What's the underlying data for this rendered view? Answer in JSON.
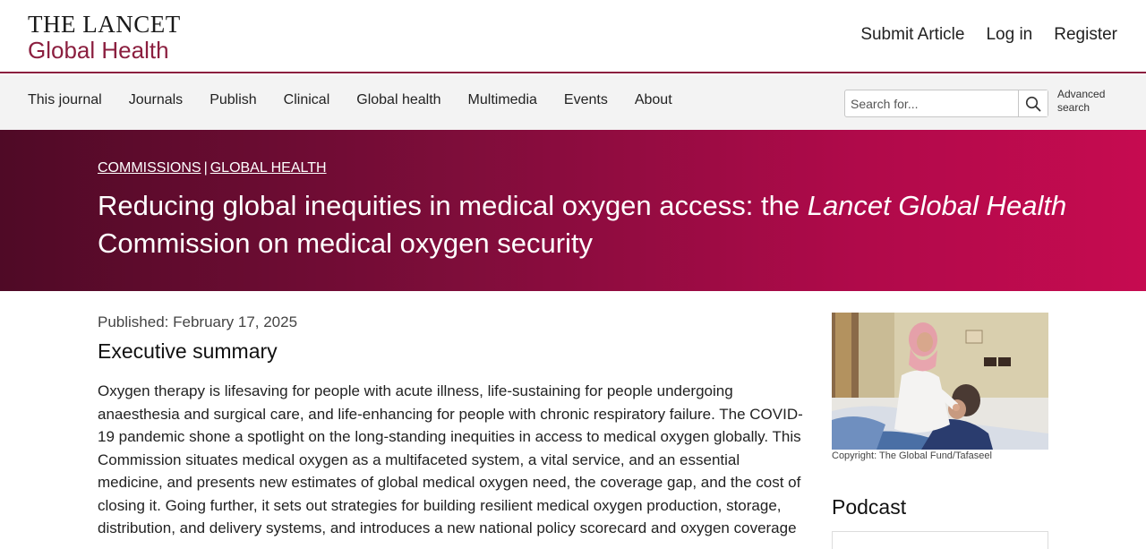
{
  "header": {
    "logo_line1": "THE LANCET",
    "logo_line2": "Global Health",
    "links": [
      "Submit Article",
      "Log in",
      "Register"
    ]
  },
  "nav": {
    "items": [
      "This journal",
      "Journals",
      "Publish",
      "Clinical",
      "Global health",
      "Multimedia",
      "Events",
      "About"
    ],
    "search_placeholder": "Search for...",
    "advanced_search_line1": "Advanced",
    "advanced_search_line2": "search"
  },
  "hero": {
    "breadcrumb": [
      "COMMISSIONS",
      "GLOBAL HEALTH"
    ],
    "breadcrumb_separator": "|",
    "title_part1": "Reducing global inequities in medical oxygen access: the ",
    "title_italic": "Lancet Global Health",
    "title_part2": "Commission on medical oxygen security"
  },
  "article": {
    "published": "Published: February 17, 2025",
    "section_title": "Executive summary",
    "summary": "Oxygen therapy is lifesaving for people with acute illness, life-sustaining for people undergoing anaesthesia and surgical care, and life-enhancing for people with chronic respiratory failure. The COVID-19 pandemic shone a spotlight on the long-standing inequities in access to medical oxygen globally. This Commission situates medical oxygen as a multifaceted system, a vital service, and an essential medicine, and presents new estimates of global medical oxygen need, the coverage gap, and the cost of closing it. Going further, it sets out strategies for building resilient medical oxygen production, storage, distribution, and delivery systems, and introduces a new national policy scorecard and oxygen coverage"
  },
  "sidebar": {
    "image_caption": "Copyright: The Global Fund/Tafaseel",
    "podcast_title": "Podcast"
  },
  "colors": {
    "brand": "#8b1f3f",
    "hero_start": "#4f0a26",
    "hero_end": "#c60b50"
  }
}
